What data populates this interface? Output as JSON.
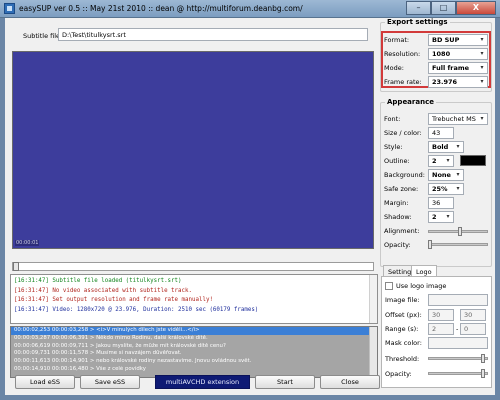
{
  "window": {
    "title": "easySUP ver 0.5 :: May 21st 2010 :: dean @ http://multiforum.deanbg.com/",
    "minimize": "–",
    "maximize": "□",
    "close": "X"
  },
  "subtitle_file": {
    "label": "Subtitle file:",
    "value": "D:\\Test\\titulkysrt.srt"
  },
  "video": {
    "timecode": "00:00:01"
  },
  "seek": {
    "position_fraction": 0.0
  },
  "log": [
    {
      "text": "[16:31:47] Subtitle file loaded (titulkysrt.srt)",
      "color": "green"
    },
    {
      "text": "[16:31:47] No video associated with subtitle track.",
      "color": "red"
    },
    {
      "text": "[16:31:47] Set output resolution and frame rate manually!",
      "color": "red"
    },
    {
      "text": "[16:31:47] Video: 1280x720 @ 23.976, Duration: 2510 sec (60179 frames)",
      "color": "blue"
    }
  ],
  "subtitles": [
    {
      "text": "00:00:02,253 00:00:03,258 > <i>V minulých dílech jste viděli...</i>",
      "selected": true
    },
    {
      "text": "00:00:03,287 00:00:06,391 > Někdo mimo Rodinu, další královské dítě.",
      "selected": false
    },
    {
      "text": "00:00:06,619 00:00:09,711 > Jakou myslíte, že může mít královské dítě cenu?",
      "selected": false
    },
    {
      "text": "00:00:09,731 00:00:11,578 > Musíme si navzájem důvěřovat.",
      "selected": false
    },
    {
      "text": "00:00:11,613 00:00:14,901 > nebo královské rodiny nezastavíme. Jnovu ovládnou svět.",
      "selected": false
    },
    {
      "text": "00:00:14,910 00:00:16,480 > Vše z celé povídky",
      "selected": false
    }
  ],
  "buttons": {
    "load": "Load eSS",
    "save": "Save eSS",
    "multi": "multiAVCHD extension",
    "start": "Start",
    "close": "Close"
  },
  "export_settings": {
    "title": "Export settings",
    "format_label": "Format:",
    "format_value": "BD SUP",
    "resolution_label": "Resolution:",
    "resolution_value": "1080",
    "mode_label": "Mode:",
    "mode_value": "Full frame",
    "framerate_label": "Frame rate:",
    "framerate_value": "23.976"
  },
  "appearance": {
    "title": "Appearance",
    "font_label": "Font:",
    "font_value": "Trebuchet MS",
    "size_label": "Size / color:",
    "size_value": "43",
    "style_label": "Style:",
    "style_value": "Bold",
    "outline_label": "Outline:",
    "outline_value": "2",
    "background_label": "Background:",
    "background_value": "None",
    "safezone_label": "Safe zone:",
    "safezone_value": "25%",
    "margin_label": "Margin:",
    "margin_value": "36",
    "shadow_label": "Shadow:",
    "shadow_value": "2",
    "alignment_label": "Alignment:",
    "opacity_label": "Opacity:",
    "alignment_fraction": 0.55,
    "opacity_fraction": 0.0
  },
  "tabs": {
    "settings": "Settings",
    "logo": "Logo"
  },
  "logo": {
    "use_logo_label": "Use logo image",
    "image_file_label": "Image file:",
    "offset_label": "Offset (px):",
    "offset_x": "30",
    "offset_y": "30",
    "range_label": "Range (s):",
    "range_from": "2",
    "range_sep": "-",
    "range_to": "0",
    "mask_color_label": "Mask color:",
    "threshold_label": "Threshold:",
    "opacity_label": "Opacity:"
  },
  "colors": {
    "video_bg": "#3d3d9c",
    "highlight_border": "#d23a3a",
    "multi_button_bg": "#0e1a74",
    "selected_row": "#3b7fd6"
  }
}
